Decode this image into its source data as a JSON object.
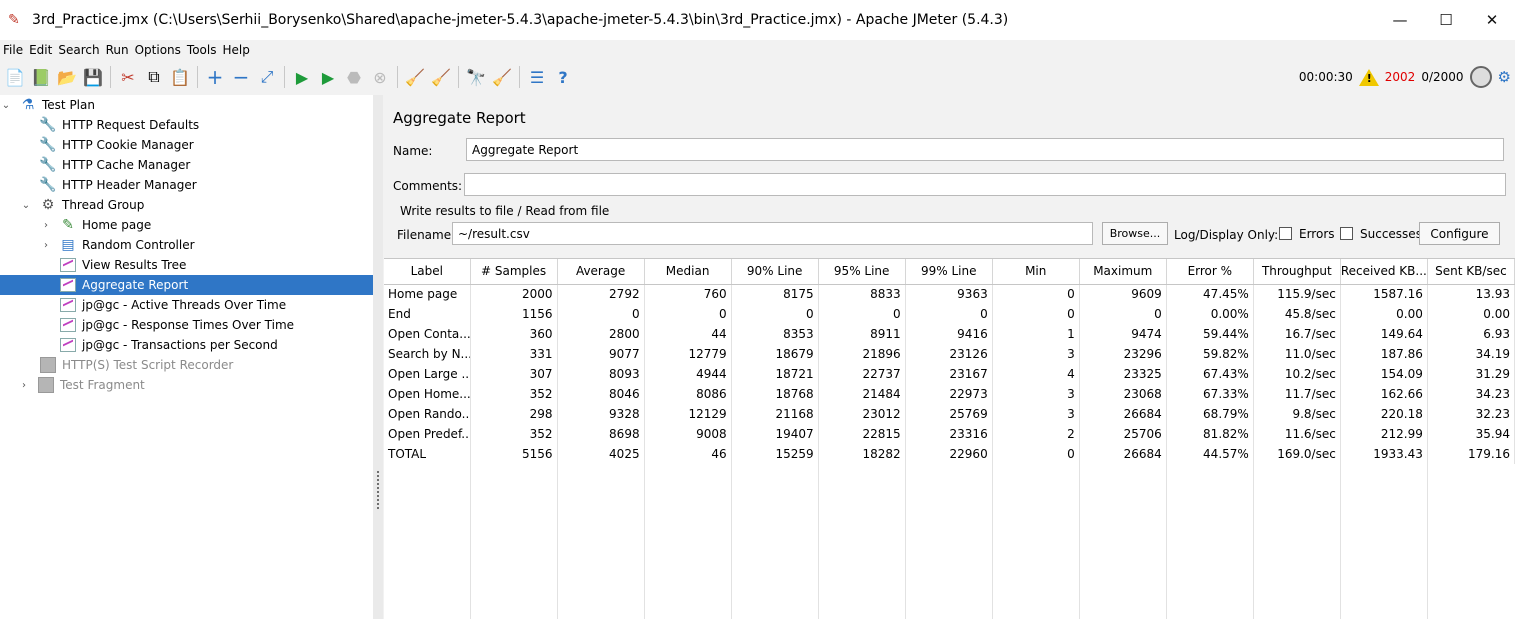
{
  "window": {
    "title": "3rd_Practice.jmx (C:\\Users\\Serhii_Borysenko\\Shared\\apache-jmeter-5.4.3\\apache-jmeter-5.4.3\\bin\\3rd_Practice.jmx) - Apache JMeter (5.4.3)",
    "minimize": "—",
    "maximize": "☐",
    "close": "✕"
  },
  "menu": [
    "File",
    "Edit",
    "Search",
    "Run",
    "Options",
    "Tools",
    "Help"
  ],
  "toolbar_status": {
    "elapsed": "00:00:30",
    "error_count": "2002",
    "threads": "0/2000"
  },
  "tree": [
    {
      "label": "Test Plan",
      "icon": "flask-icon"
    },
    {
      "label": "HTTP Request Defaults",
      "icon": "wrench-icon"
    },
    {
      "label": "HTTP Cookie Manager",
      "icon": "wrench-icon"
    },
    {
      "label": "HTTP Cache Manager",
      "icon": "wrench-icon"
    },
    {
      "label": "HTTP Header Manager",
      "icon": "wrench-icon"
    },
    {
      "label": "Thread Group",
      "icon": "gear-icon"
    },
    {
      "label": "Home page",
      "icon": "pipette-icon"
    },
    {
      "label": "Random Controller",
      "icon": "controller-icon"
    },
    {
      "label": "View Results Tree",
      "icon": "chart-icon"
    },
    {
      "label": "Aggregate Report",
      "icon": "chart-icon"
    },
    {
      "label": "jp@gc - Active Threads Over Time",
      "icon": "chart-icon"
    },
    {
      "label": "jp@gc - Response Times Over Time",
      "icon": "chart-icon"
    },
    {
      "label": "jp@gc - Transactions per Second",
      "icon": "chart-icon"
    },
    {
      "label": "HTTP(S) Test Script Recorder",
      "icon": "disabled-icon"
    },
    {
      "label": "Test Fragment",
      "icon": "disabled-icon"
    }
  ],
  "report": {
    "title": "Aggregate Report",
    "name_label": "Name:",
    "name_value": "Aggregate Report",
    "comments_label": "Comments:",
    "comments_value": "",
    "write_results_label": "Write results to file / Read from file",
    "filename_label": "Filename",
    "filename_value": "~/result.csv",
    "browse_label": "Browse...",
    "log_display_label": "Log/Display Only:",
    "errors_label": "Errors",
    "successes_label": "Successes",
    "configure_label": "Configure"
  },
  "table": {
    "headers": [
      "Label",
      "# Samples",
      "Average",
      "Median",
      "90% Line",
      "95% Line",
      "99% Line",
      "Min",
      "Maximum",
      "Error %",
      "Throughput",
      "Received KB...",
      "Sent KB/sec"
    ],
    "rows": [
      [
        "Home page",
        "2000",
        "2792",
        "760",
        "8175",
        "8833",
        "9363",
        "0",
        "9609",
        "47.45%",
        "115.9/sec",
        "1587.16",
        "13.93"
      ],
      [
        "End",
        "1156",
        "0",
        "0",
        "0",
        "0",
        "0",
        "0",
        "0",
        "0.00%",
        "45.8/sec",
        "0.00",
        "0.00"
      ],
      [
        "Open Conta...",
        "360",
        "2800",
        "44",
        "8353",
        "8911",
        "9416",
        "1",
        "9474",
        "59.44%",
        "16.7/sec",
        "149.64",
        "6.93"
      ],
      [
        "Search by N...",
        "331",
        "9077",
        "12779",
        "18679",
        "21896",
        "23126",
        "3",
        "23296",
        "59.82%",
        "11.0/sec",
        "187.86",
        "34.19"
      ],
      [
        "Open Large ...",
        "307",
        "8093",
        "4944",
        "18721",
        "22737",
        "23167",
        "4",
        "23325",
        "67.43%",
        "10.2/sec",
        "154.09",
        "31.29"
      ],
      [
        "Open Home...",
        "352",
        "8046",
        "8086",
        "18768",
        "21484",
        "22973",
        "3",
        "23068",
        "67.33%",
        "11.7/sec",
        "162.66",
        "34.23"
      ],
      [
        "Open Rando...",
        "298",
        "9328",
        "12129",
        "21168",
        "23012",
        "25769",
        "3",
        "26684",
        "68.79%",
        "9.8/sec",
        "220.18",
        "32.23"
      ],
      [
        "Open Predef...",
        "352",
        "8698",
        "9008",
        "19407",
        "22815",
        "23316",
        "2",
        "25706",
        "81.82%",
        "11.6/sec",
        "212.99",
        "35.94"
      ],
      [
        "TOTAL",
        "5156",
        "4025",
        "46",
        "15259",
        "18282",
        "22960",
        "0",
        "26684",
        "44.57%",
        "169.0/sec",
        "1933.43",
        "179.16"
      ]
    ]
  }
}
